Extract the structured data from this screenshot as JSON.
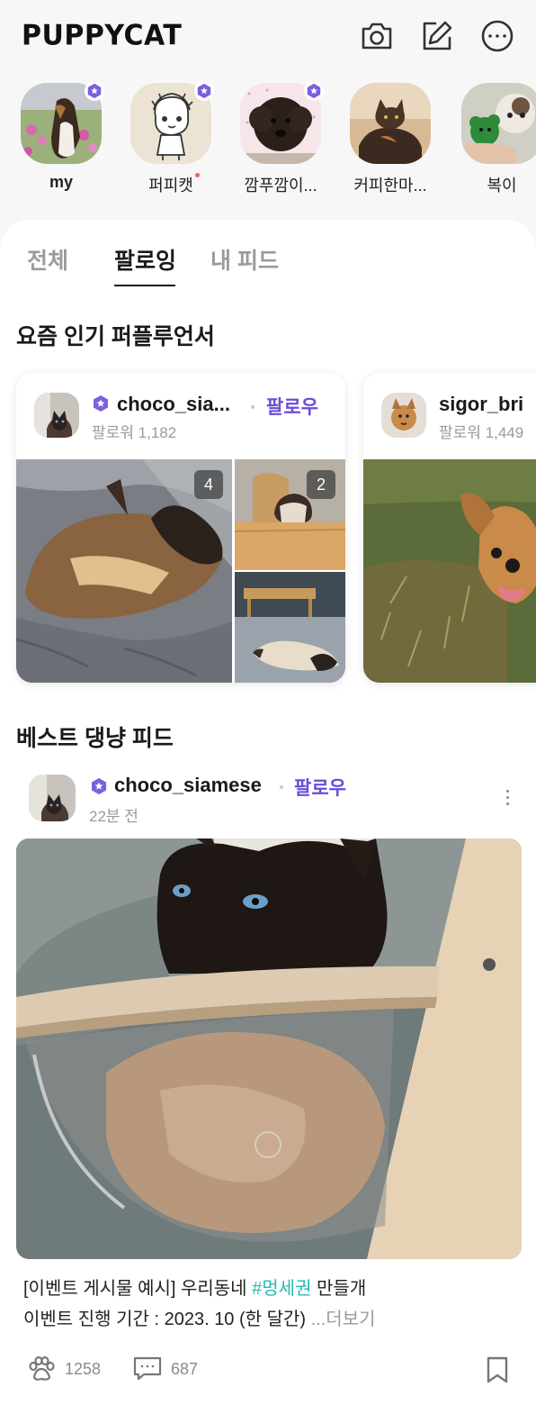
{
  "app": {
    "logo": "PUPPYCAT"
  },
  "header": {
    "icons": [
      "camera-icon",
      "edit-icon",
      "more-icon"
    ]
  },
  "stories": [
    {
      "label": "my",
      "verified": true
    },
    {
      "label": "퍼피캣",
      "verified": true,
      "new": true
    },
    {
      "label": "깜푸깜이...",
      "verified": true
    },
    {
      "label": "커피한마...",
      "verified": false
    },
    {
      "label": "복이",
      "verified": true
    }
  ],
  "tabs": [
    {
      "label": "전체",
      "active": false
    },
    {
      "label": "팔로잉",
      "active": true
    },
    {
      "label": "내 피드",
      "active": false
    }
  ],
  "influencers": {
    "title": "요즘 인기 퍼플루언서",
    "cards": [
      {
        "name": "choco_sia...",
        "follow": "팔로우",
        "followers": "팔로워 1,182",
        "counts": [
          "4",
          "2"
        ]
      },
      {
        "name": "sigor_bri",
        "followers": "팔로워 1,449"
      }
    ]
  },
  "best_feed": {
    "title": "베스트 댕냥 피드",
    "post": {
      "user": "choco_siamese",
      "follow": "팔로우",
      "time": "22분 전",
      "caption_prefix": "[이벤트 게시물 예시] 우리동네 ",
      "hashtag": "#멍세권",
      "caption_suffix": " 만들개",
      "caption_line2": "이벤트 진행 기간 : 2023. 10 (한 달간) ",
      "more": "...더보기",
      "likes": "1258",
      "comments": "687"
    }
  },
  "colors": {
    "accent": "#6a4cd6",
    "hashtag": "#2ab7b0"
  }
}
